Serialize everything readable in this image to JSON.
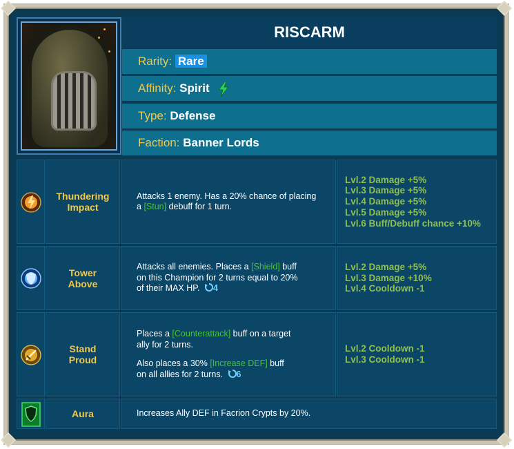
{
  "champion": {
    "name": "RISCARM",
    "rarity_label": "Rarity:",
    "rarity": "Rare",
    "affinity_label": "Affinity:",
    "affinity": "Spirit",
    "type_label": "Type:",
    "type": "Defense",
    "faction_label": "Faction:",
    "faction": "Banner Lords"
  },
  "skills": [
    {
      "name_line1": "Thundering",
      "name_line2": "Impact",
      "desc_a": "Attacks 1 enemy. Has a 20% chance of placing",
      "desc_b": "a ",
      "desc_tag": "[Stun]",
      "desc_c": " debuff for 1 turn.",
      "books": [
        "Lvl.2 Damage +5%",
        "Lvl.3 Damage +5%",
        "Lvl.4 Damage +5%",
        "Lvl.5 Damage +5%",
        "Lvl.6 Buff/Debuff chance +10%"
      ],
      "icon": "thunder-skill-icon"
    },
    {
      "name_line1": "Tower",
      "name_line2": "Above",
      "desc_a": "Attacks all enemies. Places a ",
      "desc_tag": "[Shield]",
      "desc_b": " buff",
      "desc_c": "on this Champion for 2 turns equal to 20%",
      "desc_d": "of their MAX HP.",
      "cooldown": "4",
      "books": [
        "Lvl.2 Damage +5%",
        "Lvl.3 Damage +10%",
        "Lvl.4 Cooldown -1"
      ],
      "icon": "shield-skill-icon"
    },
    {
      "name_line1": "Stand",
      "name_line2": "Proud",
      "desc_a": "Places a ",
      "desc_tag": "[Counterattack]",
      "desc_b": " buff on a target",
      "desc_c": "ally for 2 turns.",
      "desc_d": "Also places a 30% ",
      "desc_tag2": "[Increase DEF]",
      "desc_e": " buff",
      "desc_f": "on all allies for 2 turns.",
      "cooldown": "6",
      "books": [
        "Lvl.2 Cooldown -1",
        "Lvl.3 Cooldown -1"
      ],
      "icon": "sword-skill-icon"
    }
  ],
  "aura": {
    "name": "Aura",
    "desc": "Increases Ally DEF in Facrion Crypts by 20%.",
    "icon": "aura-shield-icon"
  },
  "colors": {
    "panel": "#0a3e5e",
    "attr_row": "#0f6f8f",
    "gold_text": "#f1c84a",
    "book_green": "#8fbf4f",
    "tag_green": "#45c431",
    "rare_blue": "#1b8fe0"
  }
}
